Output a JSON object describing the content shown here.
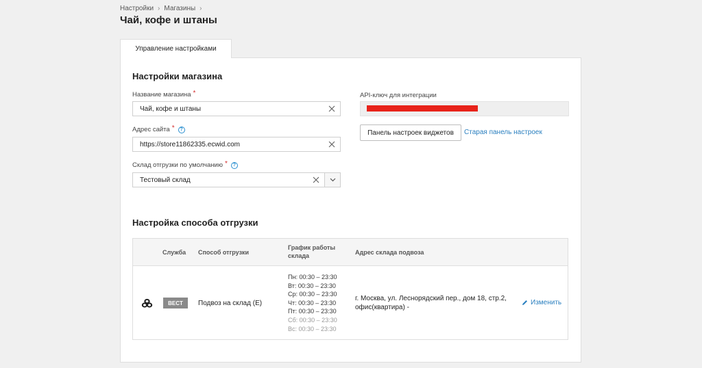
{
  "breadcrumb": {
    "items": [
      "Настройки",
      "Магазины"
    ],
    "separator": "›"
  },
  "page": {
    "title": "Чай, кофе и штаны"
  },
  "tabs": [
    {
      "label": "Управление настройками",
      "active": true
    }
  ],
  "store_settings": {
    "title": "Настройки магазина",
    "store_name": {
      "label": "Название магазина",
      "value": "Чай, кофе и штаны"
    },
    "site_address": {
      "label": "Адрес сайта",
      "value": "https://store11862335.ecwid.com"
    },
    "warehouse": {
      "label": "Склад отгрузки по умолчанию",
      "value": "Тестовый склад"
    },
    "api_key": {
      "label": "API-ключ для интеграции"
    },
    "widget_button": "Панель настроек виджетов",
    "old_panel_link": "Старая панель настроек"
  },
  "shipping": {
    "title": "Настройка способа отгрузки",
    "columns": {
      "service": "Служба",
      "method": "Способ отгрузки",
      "schedule_line1": "График работы",
      "schedule_line2": "склада",
      "address": "Адрес склада подвоза"
    },
    "rows": [
      {
        "service_badge": "BECT",
        "method": "Подвоз на склад (Е)",
        "schedule": [
          {
            "text": "Пн: 00:30 – 23:30",
            "off": false
          },
          {
            "text": "Вт: 00:30 – 23:30",
            "off": false
          },
          {
            "text": "Ср: 00:30 – 23:30",
            "off": false
          },
          {
            "text": "Чт: 00:30 – 23:30",
            "off": false
          },
          {
            "text": "Пт: 00:30 – 23:30",
            "off": false
          },
          {
            "text": "Сб: 00:30 – 23:30",
            "off": true
          },
          {
            "text": "Вс: 00:30 – 23:30",
            "off": true
          }
        ],
        "address_line1": "г. Москва, ул. Леснорядский пер., дом 18, стр.2,",
        "address_line2": "офис(квартира) -",
        "edit_label": "Изменить"
      }
    ]
  },
  "colors": {
    "accent": "#2a7fbf",
    "required": "#d32f2f",
    "redaction": "#e8231a",
    "badge": "#8a8a8a"
  }
}
